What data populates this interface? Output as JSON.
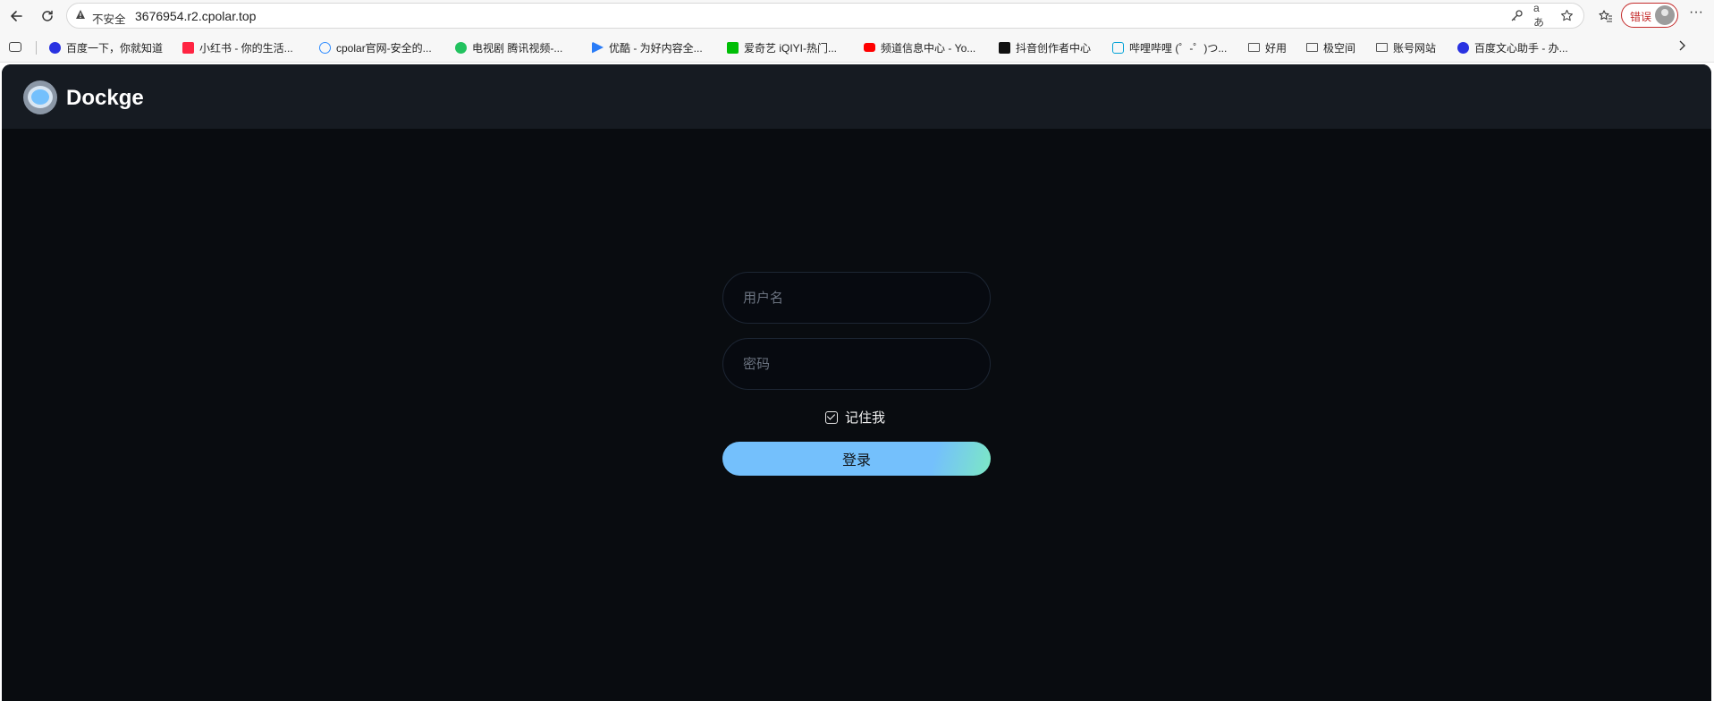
{
  "browser": {
    "url_warning": "不安全",
    "url": "3676954.r2.cpolar.top",
    "error_badge": "错误"
  },
  "bookmarks": [
    {
      "label": "百度一下，你就知道",
      "icon": "baidu-icon",
      "color": "#2932e1"
    },
    {
      "label": "小红书 - 你的生活...",
      "icon": "xiaohongshu-icon",
      "color": "#ff2442"
    },
    {
      "label": "cpolar官网-安全的...",
      "icon": "cpolar-icon",
      "color": "#2f8cff"
    },
    {
      "label": "电视剧 腾讯视频-...",
      "icon": "tencent-video-icon",
      "color": "#22c25f"
    },
    {
      "label": "优酷 - 为好内容全...",
      "icon": "youku-icon",
      "color": "#2a7cf7"
    },
    {
      "label": "爱奇艺 iQIYI-热门...",
      "icon": "iqiyi-icon",
      "color": "#00be06"
    },
    {
      "label": "频道信息中心 - Yo...",
      "icon": "youtube-icon",
      "color": "#ff0000"
    },
    {
      "label": "抖音创作者中心",
      "icon": "douyin-icon",
      "color": "#111111"
    },
    {
      "label": "哔哩哔哩 (゜-゜)つ...",
      "icon": "bilibili-icon",
      "color": "#00a1d6"
    },
    {
      "label": "好用",
      "icon": "folder-icon"
    },
    {
      "label": "极空间",
      "icon": "folder-icon"
    },
    {
      "label": "账号网站",
      "icon": "folder-icon"
    },
    {
      "label": "百度文心助手 - 办...",
      "icon": "baidu-icon",
      "color": "#2932e1"
    }
  ],
  "app": {
    "brand": "Dockge",
    "login": {
      "username_placeholder": "用户名",
      "password_placeholder": "密码",
      "remember_me": "记住我",
      "remember_checked": true,
      "submit": "登录"
    },
    "colors": {
      "header_bg": "#161b22",
      "page_bg": "#090c10",
      "accent": "#74c0fc",
      "accent_end": "#7ce8c4"
    }
  }
}
